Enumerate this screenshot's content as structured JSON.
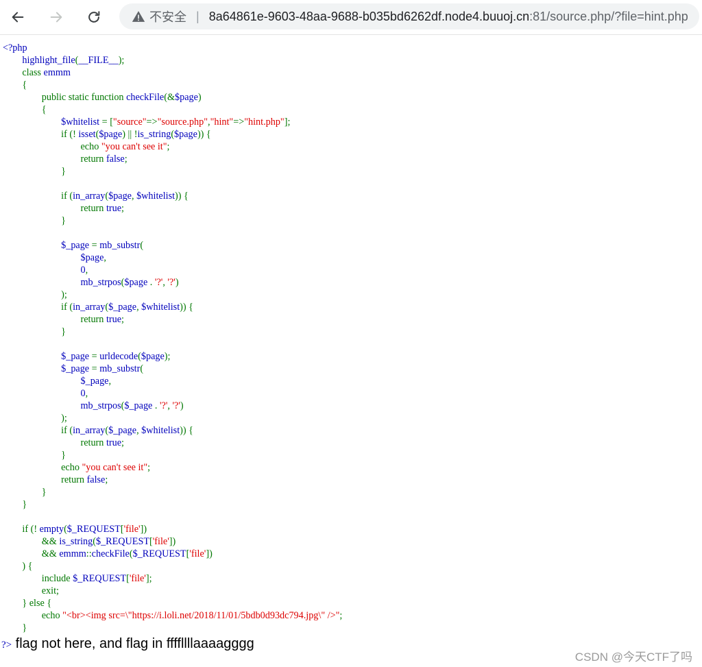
{
  "browser": {
    "security_label": "不安全",
    "separator": "|",
    "url_host": "8a64861e-9603-48aa-9688-b035bd6262df.node4.buuoj.cn",
    "url_rest": ":81/source.php/?file=hint.php"
  },
  "source": [
    [
      [
        "d",
        "<?php"
      ]
    ],
    [
      [
        "d",
        "        highlight_file"
      ],
      [
        "k",
        "("
      ],
      [
        "d",
        "__FILE__"
      ],
      [
        "k",
        ");"
      ]
    ],
    [
      [
        "k",
        "        class "
      ],
      [
        "d",
        "emmm"
      ]
    ],
    [
      [
        "k",
        "        {"
      ]
    ],
    [
      [
        "k",
        "                public static function "
      ],
      [
        "d",
        "checkFile"
      ],
      [
        "k",
        "(&"
      ],
      [
        "d",
        "$page"
      ],
      [
        "k",
        ")"
      ]
    ],
    [
      [
        "k",
        "                {"
      ]
    ],
    [
      [
        "d",
        "                        $whitelist "
      ],
      [
        "k",
        "= ["
      ],
      [
        "s",
        "\"source\""
      ],
      [
        "k",
        "=>"
      ],
      [
        "s",
        "\"source.php\""
      ],
      [
        "k",
        ","
      ],
      [
        "s",
        "\"hint\""
      ],
      [
        "k",
        "=>"
      ],
      [
        "s",
        "\"hint.php\""
      ],
      [
        "k",
        "];"
      ]
    ],
    [
      [
        "k",
        "                        if (! "
      ],
      [
        "d",
        "isset"
      ],
      [
        "k",
        "("
      ],
      [
        "d",
        "$page"
      ],
      [
        "k",
        ") || !"
      ],
      [
        "d",
        "is_string"
      ],
      [
        "k",
        "("
      ],
      [
        "d",
        "$page"
      ],
      [
        "k",
        ")) {"
      ]
    ],
    [
      [
        "k",
        "                                echo "
      ],
      [
        "s",
        "\"you can't see it\""
      ],
      [
        "k",
        ";"
      ]
    ],
    [
      [
        "k",
        "                                return "
      ],
      [
        "d",
        "false"
      ],
      [
        "k",
        ";"
      ]
    ],
    [
      [
        "k",
        "                        }"
      ]
    ],
    [],
    [
      [
        "k",
        "                        if ("
      ],
      [
        "d",
        "in_array"
      ],
      [
        "k",
        "("
      ],
      [
        "d",
        "$page"
      ],
      [
        "k",
        ", "
      ],
      [
        "d",
        "$whitelist"
      ],
      [
        "k",
        ")) {"
      ]
    ],
    [
      [
        "k",
        "                                return "
      ],
      [
        "d",
        "true"
      ],
      [
        "k",
        ";"
      ]
    ],
    [
      [
        "k",
        "                        }"
      ]
    ],
    [],
    [
      [
        "d",
        "                        $_page "
      ],
      [
        "k",
        "= "
      ],
      [
        "d",
        "mb_substr"
      ],
      [
        "k",
        "("
      ]
    ],
    [
      [
        "d",
        "                                $page"
      ],
      [
        "k",
        ","
      ]
    ],
    [
      [
        "d",
        "                                0"
      ],
      [
        "k",
        ","
      ]
    ],
    [
      [
        "d",
        "                                mb_strpos"
      ],
      [
        "k",
        "("
      ],
      [
        "d",
        "$page "
      ],
      [
        "k",
        ". "
      ],
      [
        "s",
        "'?'"
      ],
      [
        "k",
        ", "
      ],
      [
        "s",
        "'?'"
      ],
      [
        "k",
        ")"
      ]
    ],
    [
      [
        "k",
        "                        );"
      ]
    ],
    [
      [
        "k",
        "                        if ("
      ],
      [
        "d",
        "in_array"
      ],
      [
        "k",
        "("
      ],
      [
        "d",
        "$_page"
      ],
      [
        "k",
        ", "
      ],
      [
        "d",
        "$whitelist"
      ],
      [
        "k",
        ")) {"
      ]
    ],
    [
      [
        "k",
        "                                return "
      ],
      [
        "d",
        "true"
      ],
      [
        "k",
        ";"
      ]
    ],
    [
      [
        "k",
        "                        }"
      ]
    ],
    [],
    [
      [
        "d",
        "                        $_page "
      ],
      [
        "k",
        "= "
      ],
      [
        "d",
        "urldecode"
      ],
      [
        "k",
        "("
      ],
      [
        "d",
        "$page"
      ],
      [
        "k",
        ");"
      ]
    ],
    [
      [
        "d",
        "                        $_page "
      ],
      [
        "k",
        "= "
      ],
      [
        "d",
        "mb_substr"
      ],
      [
        "k",
        "("
      ]
    ],
    [
      [
        "d",
        "                                $_page"
      ],
      [
        "k",
        ","
      ]
    ],
    [
      [
        "d",
        "                                0"
      ],
      [
        "k",
        ","
      ]
    ],
    [
      [
        "d",
        "                                mb_strpos"
      ],
      [
        "k",
        "("
      ],
      [
        "d",
        "$_page "
      ],
      [
        "k",
        ". "
      ],
      [
        "s",
        "'?'"
      ],
      [
        "k",
        ", "
      ],
      [
        "s",
        "'?'"
      ],
      [
        "k",
        ")"
      ]
    ],
    [
      [
        "k",
        "                        );"
      ]
    ],
    [
      [
        "k",
        "                        if ("
      ],
      [
        "d",
        "in_array"
      ],
      [
        "k",
        "("
      ],
      [
        "d",
        "$_page"
      ],
      [
        "k",
        ", "
      ],
      [
        "d",
        "$whitelist"
      ],
      [
        "k",
        ")) {"
      ]
    ],
    [
      [
        "k",
        "                                return "
      ],
      [
        "d",
        "true"
      ],
      [
        "k",
        ";"
      ]
    ],
    [
      [
        "k",
        "                        }"
      ]
    ],
    [
      [
        "k",
        "                        echo "
      ],
      [
        "s",
        "\"you can't see it\""
      ],
      [
        "k",
        ";"
      ]
    ],
    [
      [
        "k",
        "                        return "
      ],
      [
        "d",
        "false"
      ],
      [
        "k",
        ";"
      ]
    ],
    [
      [
        "k",
        "                }"
      ]
    ],
    [
      [
        "k",
        "        }"
      ]
    ],
    [],
    [
      [
        "k",
        "        if (! "
      ],
      [
        "d",
        "empty"
      ],
      [
        "k",
        "("
      ],
      [
        "d",
        "$_REQUEST"
      ],
      [
        "k",
        "["
      ],
      [
        "s",
        "'file'"
      ],
      [
        "k",
        "])"
      ]
    ],
    [
      [
        "k",
        "                && "
      ],
      [
        "d",
        "is_string"
      ],
      [
        "k",
        "("
      ],
      [
        "d",
        "$_REQUEST"
      ],
      [
        "k",
        "["
      ],
      [
        "s",
        "'file'"
      ],
      [
        "k",
        "])"
      ]
    ],
    [
      [
        "k",
        "                && "
      ],
      [
        "d",
        "emmm"
      ],
      [
        "k",
        "::"
      ],
      [
        "d",
        "checkFile"
      ],
      [
        "k",
        "("
      ],
      [
        "d",
        "$_REQUEST"
      ],
      [
        "k",
        "["
      ],
      [
        "s",
        "'file'"
      ],
      [
        "k",
        "])"
      ]
    ],
    [
      [
        "k",
        "        ) {"
      ]
    ],
    [
      [
        "k",
        "                include "
      ],
      [
        "d",
        "$_REQUEST"
      ],
      [
        "k",
        "["
      ],
      [
        "s",
        "'file'"
      ],
      [
        "k",
        "];"
      ]
    ],
    [
      [
        "k",
        "                exit;"
      ]
    ],
    [
      [
        "k",
        "        } else {"
      ]
    ],
    [
      [
        "k",
        "                echo "
      ],
      [
        "s",
        "\"<br><img src=\\\"https://i.loli.net/2018/11/01/5bdb0d93dc794.jpg\\\" />\""
      ],
      [
        "k",
        ";"
      ]
    ],
    [
      [
        "k",
        "        }"
      ]
    ]
  ],
  "output": {
    "php_close": "?>",
    "message": " flag not here, and flag in ffffllllaaaagggg"
  },
  "watermark": "CSDN @今天CTF了吗",
  "colors": {
    "default": "#0000bb",
    "keyword": "#007700",
    "string": "#dd0000"
  },
  "icons": [
    "back-arrow-icon",
    "forward-arrow-icon",
    "reload-icon",
    "warning-icon"
  ]
}
